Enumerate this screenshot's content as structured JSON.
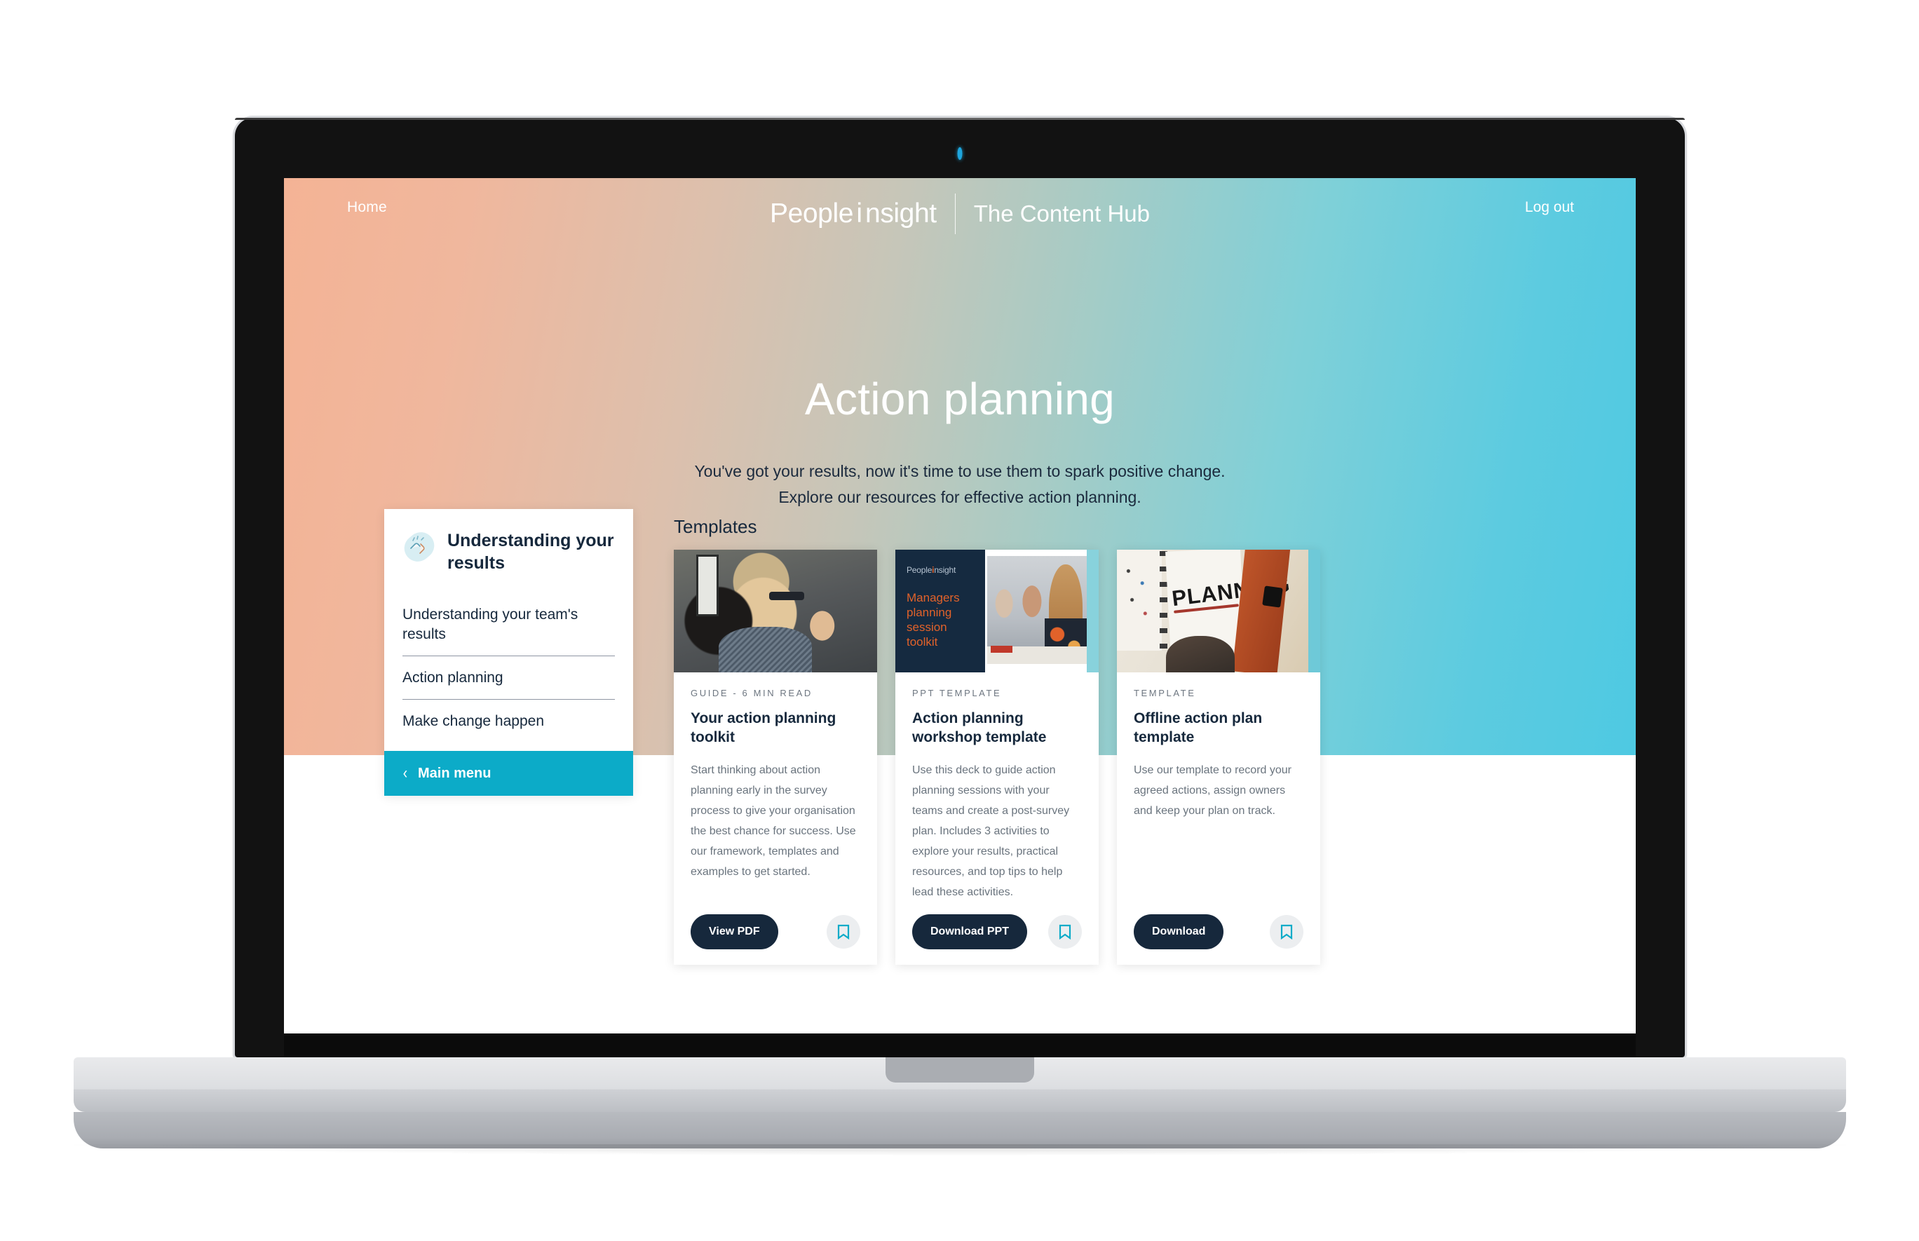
{
  "nav": {
    "home_label": "Home",
    "brand_prefix": "People",
    "brand_i": "i",
    "brand_suffix": "nsight",
    "brand_sub": "The Content Hub",
    "logout_label": "Log out"
  },
  "hero": {
    "title": "Action planning",
    "subtitle_line1": "You've got your results, now it's time to use them to spark positive change.",
    "subtitle_line2": "Explore our resources for effective action planning."
  },
  "section": {
    "label": "Templates"
  },
  "sidebar": {
    "title": "Understanding your results",
    "icon": "fist-bump-plaster-icon",
    "links": [
      {
        "label": "Understanding your team's results"
      },
      {
        "label": "Action planning"
      },
      {
        "label": "Make change happen"
      }
    ],
    "main_menu_label": "Main menu",
    "main_menu_chevron": "‹",
    "main_menu_color": "#0cabc8"
  },
  "cards": [
    {
      "eyebrow": "GUIDE - 6 MIN READ",
      "title": "Your action planning toolkit",
      "description": "Start thinking about action planning early in the survey process to give your organisation the best chance for success. Use our framework, templates and examples to get started.",
      "cta_label": "View PDF",
      "favourite_icon": "bookmark-icon",
      "thumb": "two-colleagues-talking-photo"
    },
    {
      "eyebrow": "PPT TEMPLATE",
      "title": "Action planning workshop template",
      "description": "Use this deck to guide action planning sessions with your teams and create a post-survey plan. Includes 3 activities to explore your results, practical resources, and top tips to help lead these activities.",
      "cta_label": "Download PPT",
      "favourite_icon": "bookmark-icon",
      "thumb": "managers-planning-session-toolkit-deck",
      "thumb_deck": {
        "logo_prefix": "People",
        "logo_i": "i",
        "logo_suffix": "nsight",
        "headline": "Managers planning session toolkit"
      }
    },
    {
      "eyebrow": "TEMPLATE",
      "title": "Offline action plan template",
      "description": "Use our template to record your agreed actions, assign owners and keep your plan on track.",
      "cta_label": "Download",
      "favourite_icon": "bookmark-icon",
      "thumb": "planning-notebook-photo",
      "thumb_word": "PLANNING"
    }
  ],
  "colors": {
    "brand_teal": "#0cabc8",
    "ink_navy": "#16283c",
    "body_grey": "#6a747e",
    "gradient_left": "#f4b395",
    "gradient_right": "#4ec9e2",
    "accent_orange": "#e2622a"
  }
}
